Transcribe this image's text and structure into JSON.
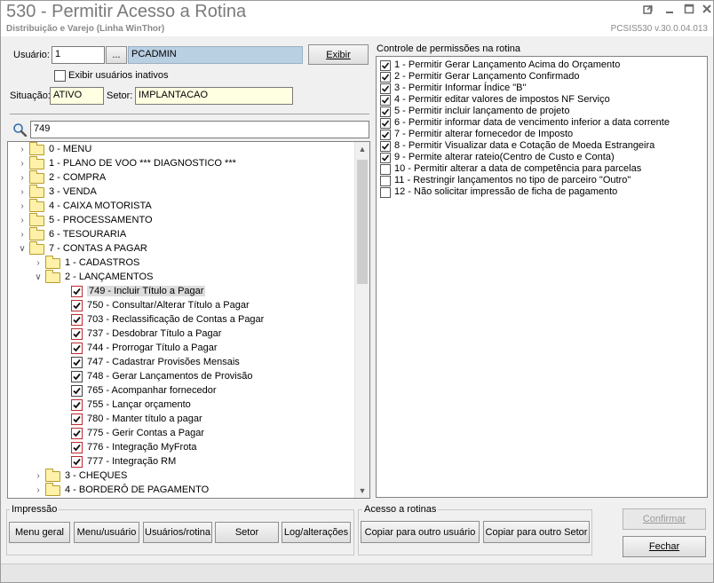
{
  "window": {
    "title": "530 - Permitir Acesso a Rotina",
    "subtitle": "Distribuição e Varejo (Linha WinThor)",
    "version": "PCSIS530  v.30.0.04.013",
    "controls": [
      "restore-icon",
      "minimize-icon",
      "maximize-icon",
      "close-icon"
    ]
  },
  "user_form": {
    "usuario_label": "Usuário:",
    "usuario_value": "1",
    "lookup_label": "...",
    "usuario_name": "PCADMIN",
    "exibir_label": "Exibir",
    "inativos_label": "Exibir usuários inativos",
    "situacao_label": "Situação:",
    "situacao_value": "ATIVO",
    "setor_label": "Setor:",
    "setor_value": "IMPLANTACAO"
  },
  "search": {
    "icon": "search-icon",
    "value": "749"
  },
  "tree": {
    "items": [
      {
        "label": "0 - MENU",
        "level": 0,
        "type": "folder",
        "expanded": false
      },
      {
        "label": "1 - PLANO DE VOO   *** DIAGNOSTICO ***",
        "level": 0,
        "type": "folder",
        "expanded": false
      },
      {
        "label": "2 - COMPRA",
        "level": 0,
        "type": "folder",
        "expanded": false
      },
      {
        "label": "3 - VENDA",
        "level": 0,
        "type": "folder",
        "expanded": false
      },
      {
        "label": "4 - CAIXA MOTORISTA",
        "level": 0,
        "type": "folder",
        "expanded": false
      },
      {
        "label": "5 - PROCESSAMENTO",
        "level": 0,
        "type": "folder",
        "expanded": false
      },
      {
        "label": "6 - TESOURARIA",
        "level": 0,
        "type": "folder",
        "expanded": false
      },
      {
        "label": "7 - CONTAS A PAGAR",
        "level": 0,
        "type": "folder",
        "expanded": true
      },
      {
        "label": "1 - CADASTROS",
        "level": 1,
        "type": "folder",
        "expanded": false
      },
      {
        "label": "2 - LANÇAMENTOS",
        "level": 1,
        "type": "folder",
        "expanded": true
      },
      {
        "label": "749 - Incluir Título a Pagar",
        "level": 2,
        "type": "check",
        "checked": true,
        "red": true,
        "selected": true
      },
      {
        "label": "750 - Consultar/Alterar Título a Pagar",
        "level": 2,
        "type": "check",
        "checked": true,
        "red": true
      },
      {
        "label": "703 - Reclassificação de Contas a Pagar",
        "level": 2,
        "type": "check",
        "checked": true,
        "red": true
      },
      {
        "label": "737 - Desdobrar Título a Pagar",
        "level": 2,
        "type": "check",
        "checked": true,
        "red": true
      },
      {
        "label": "744 - Prorrogar Título a Pagar",
        "level": 2,
        "type": "check",
        "checked": true,
        "red": true
      },
      {
        "label": "747 - Cadastrar Provisões Mensais",
        "level": 2,
        "type": "check",
        "checked": true,
        "red": false
      },
      {
        "label": "748 - Gerar Lançamentos de Provisão",
        "level": 2,
        "type": "check",
        "checked": true,
        "red": false
      },
      {
        "label": "765 - Acompanhar fornecedor",
        "level": 2,
        "type": "check",
        "checked": true,
        "red": false
      },
      {
        "label": "755 - Lançar orçamento",
        "level": 2,
        "type": "check",
        "checked": true,
        "red": true
      },
      {
        "label": "780 - Manter título a pagar",
        "level": 2,
        "type": "check",
        "checked": true,
        "red": true
      },
      {
        "label": "775 - Gerir Contas a Pagar",
        "level": 2,
        "type": "check",
        "checked": true,
        "red": true
      },
      {
        "label": "776 - Integração MyFrota",
        "level": 2,
        "type": "check",
        "checked": true,
        "red": true
      },
      {
        "label": "777 - Integração RM",
        "level": 2,
        "type": "check",
        "checked": true,
        "red": true
      },
      {
        "label": "3 - CHEQUES",
        "level": 1,
        "type": "folder",
        "expanded": false
      },
      {
        "label": "4 - BORDERÔ DE PAGAMENTO",
        "level": 1,
        "type": "folder",
        "expanded": false
      }
    ]
  },
  "permissions": {
    "title": "Controle de permissões na rotina",
    "items": [
      {
        "label": "1 - Permitir Gerar Lançamento Acima do Orçamento",
        "checked": true
      },
      {
        "label": "2 - Permitir Gerar Lançamento Confirmado",
        "checked": true
      },
      {
        "label": "3 - Permitir Informar Índice \"B\"",
        "checked": true
      },
      {
        "label": "4 - Permitir editar valores de impostos NF Serviço",
        "checked": true
      },
      {
        "label": "5 - Permitir incluir lançamento de projeto",
        "checked": true
      },
      {
        "label": "6 - Permitir informar data de vencimento inferior a data corrente",
        "checked": true
      },
      {
        "label": "7 - Permitir alterar fornecedor de Imposto",
        "checked": true
      },
      {
        "label": "8 - Permitir Visualizar data e Cotação de Moeda Estrangeira",
        "checked": true
      },
      {
        "label": "9 - Permite alterar rateio(Centro de Custo e Conta)",
        "checked": true
      },
      {
        "label": "10 - Permitir alterar a data de competência para parcelas",
        "checked": false
      },
      {
        "label": "11 - Restringir lançamentos no tipo de parceiro \"Outro\"",
        "checked": false
      },
      {
        "label": "12 - Não solicitar impressão de ficha de pagamento",
        "checked": false
      }
    ]
  },
  "impressao": {
    "title": "Impressão",
    "buttons": [
      "Menu geral",
      "Menu/usuário",
      "Usuários/rotina",
      "Setor",
      "Log/alterações"
    ]
  },
  "acesso": {
    "title": "Acesso a rotinas",
    "buttons": [
      "Copiar para outro usuário",
      "Copiar para outro Setor"
    ]
  },
  "actions": {
    "confirmar": "Confirmar",
    "fechar": "Fechar"
  },
  "colors": {
    "title_text": "#7a7a7a",
    "accent_red": "#c0282c",
    "folder": "#fff1a8",
    "selection": "#dcdcdc"
  }
}
